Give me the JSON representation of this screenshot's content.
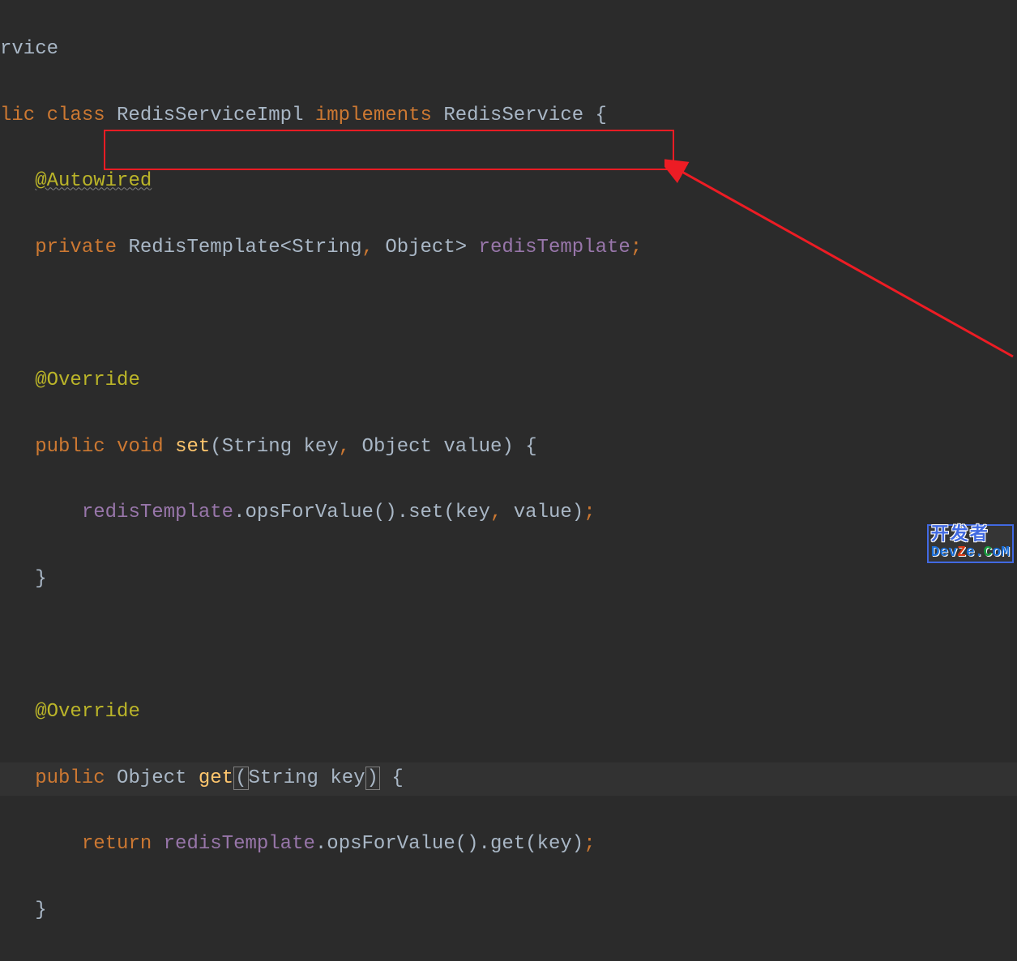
{
  "code": {
    "line1": {
      "rvice": "rvice"
    },
    "line2": {
      "lic": "lic ",
      "class": "class ",
      "name": "RedisServiceImpl ",
      "implements": "implements ",
      "iface": "RedisService ",
      "brace": "{"
    },
    "line3": {
      "indent": "   ",
      "annotation": "@Autowired"
    },
    "line4": {
      "indent": "   ",
      "private": "private ",
      "type": "RedisTemplate",
      "lt": "<",
      "str": "String",
      "comma": ", ",
      "obj": "Object",
      "gt": "> ",
      "field": "redisTemplate",
      "semi": ";"
    },
    "line5": "",
    "line6": {
      "indent": "   ",
      "annotation": "@Override"
    },
    "line7": {
      "indent": "   ",
      "public": "public ",
      "void": "void ",
      "method": "set",
      "lp": "(",
      "p1t": "String ",
      "p1n": "key",
      "c": ", ",
      "p2t": "Object ",
      "p2n": "value",
      "rp": ") ",
      "brace": "{"
    },
    "line8": {
      "indent": "       ",
      "field": "redisTemplate",
      "dot1": ".",
      "m1": "opsForValue",
      "lp1": "()",
      "dot2": ".",
      "m2": "set",
      "lp2": "(",
      "a1": "key",
      "c": ", ",
      "a2": "value",
      "rp2": ")",
      "semi": ";"
    },
    "line9": {
      "indent": "   ",
      "brace": "}"
    },
    "line10": "",
    "line11": {
      "indent": "   ",
      "annotation": "@Override"
    },
    "line12": {
      "indent": "   ",
      "public": "public ",
      "obj": "Object ",
      "method": "get",
      "lp": "(",
      "p1t": "String ",
      "p1n": "key",
      "rp": ")",
      "sp": " ",
      "brace": "{"
    },
    "line13": {
      "indent": "       ",
      "return": "return ",
      "field": "redisTemplate",
      "dot1": ".",
      "m1": "opsForValue",
      "lp1": "()",
      "dot2": ".",
      "m2": "get",
      "lp2": "(",
      "a1": "key",
      "rp2": ")",
      "semi": ";"
    },
    "line14": {
      "indent": "   ",
      "brace": "}"
    }
  },
  "watermark": {
    "top": "开发者",
    "d": "D",
    "ev": "ev",
    "z": "Z",
    "e": "e",
    "dot": ".",
    "c": "C",
    "o": "o",
    "m": "M"
  }
}
